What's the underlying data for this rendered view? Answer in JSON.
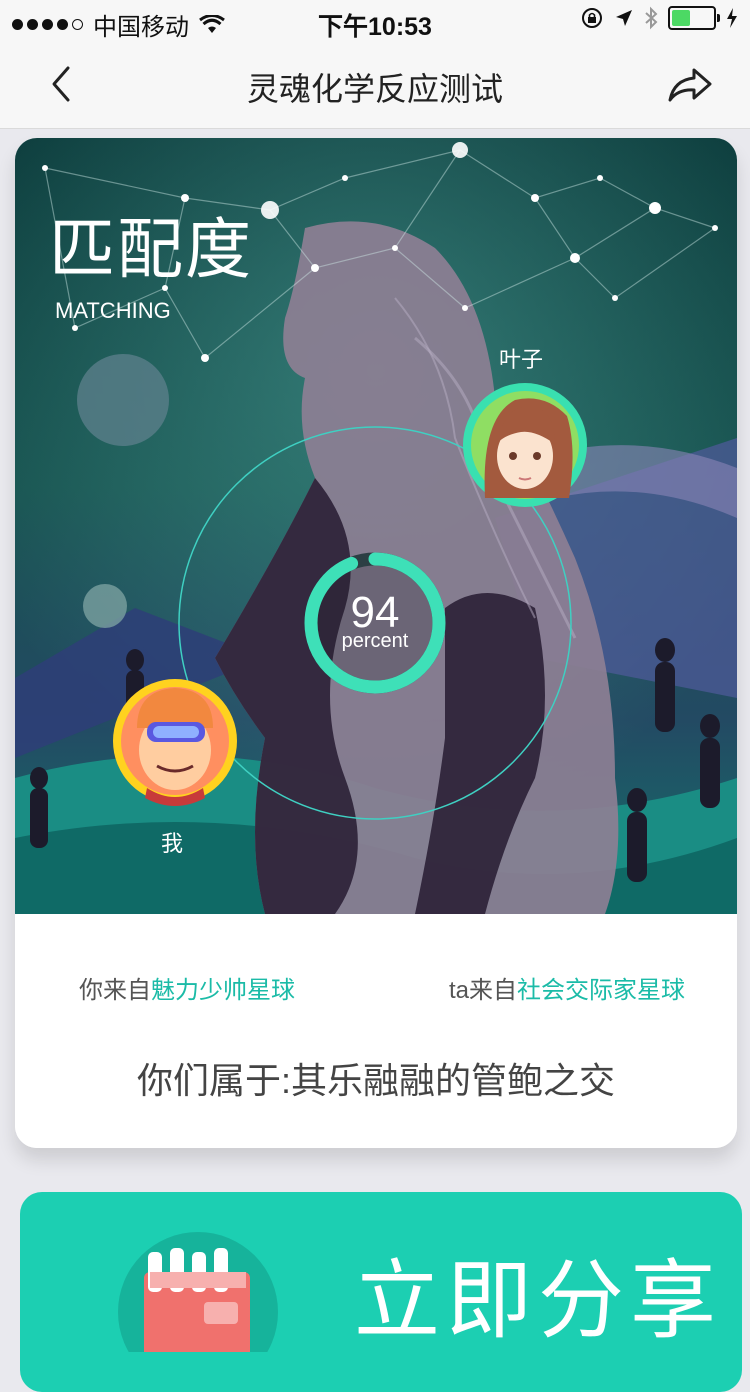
{
  "status_bar": {
    "carrier": "中国移动",
    "time": "下午10:53"
  },
  "nav": {
    "title": "灵魂化学反应测试"
  },
  "match": {
    "title": "匹配度",
    "subtitle": "MATCHING",
    "percent": "94",
    "percent_label": "percent",
    "percent_value": 94,
    "partner_name": "叶子",
    "self_name": "我"
  },
  "origin": {
    "self_prefix": "你来自",
    "self_planet": "魅力少帅星球",
    "partner_prefix": "ta来自",
    "partner_planet": "社会交际家星球"
  },
  "result": {
    "text": "你们属于:其乐融融的管鲍之交"
  },
  "share": {
    "label": "立即分享"
  },
  "colors": {
    "accent": "#1ccfb2",
    "highlight": "#1bbba7",
    "ring": "#3ee0b8",
    "self_ring": "#ffd21f",
    "partner_ring": "#39e0b0"
  }
}
